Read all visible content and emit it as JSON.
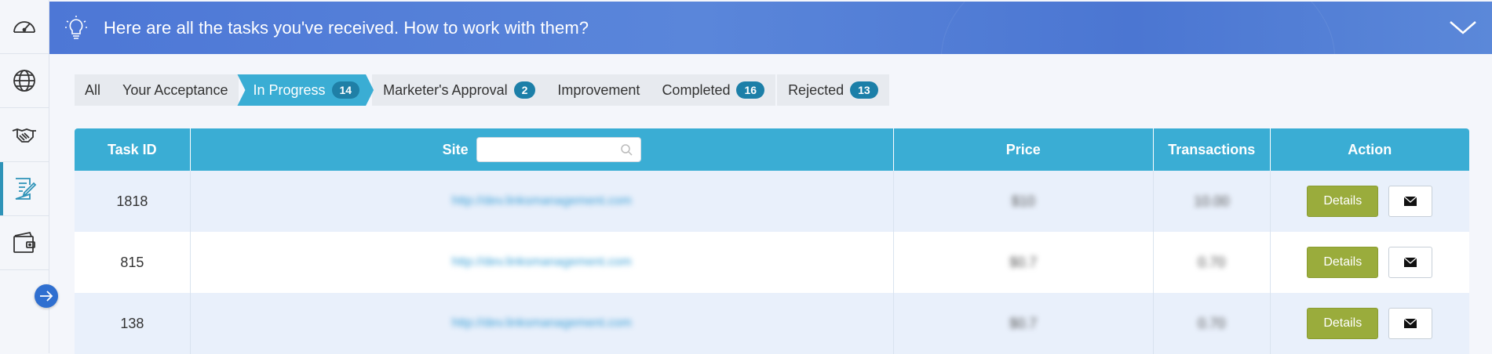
{
  "banner": {
    "title": "Here are all the tasks you've received. How to work with them?"
  },
  "sidebar": {
    "items": [
      {
        "icon": "speedometer-icon"
      },
      {
        "icon": "globe-icon"
      },
      {
        "icon": "handshake-icon"
      },
      {
        "icon": "edit-document-icon",
        "active": true
      },
      {
        "icon": "wallet-icon"
      }
    ]
  },
  "tabs": [
    {
      "label": "All"
    },
    {
      "label": "Your Acceptance"
    },
    {
      "label": "In Progress",
      "count": "14",
      "active": true
    },
    {
      "label": "Marketer's Approval",
      "count": "2"
    },
    {
      "label": "Improvement"
    },
    {
      "label": "Completed",
      "count": "16"
    },
    {
      "label": "Rejected",
      "count": "13"
    }
  ],
  "table": {
    "headers": {
      "task_id": "Task ID",
      "site": "Site",
      "price": "Price",
      "transactions": "Transactions",
      "action": "Action"
    },
    "search_placeholder": "",
    "rows": [
      {
        "task_id": "1818",
        "site": "http://dev.linksmanagement.com",
        "price": "$10",
        "transactions": "10.00"
      },
      {
        "task_id": "815",
        "site": "http://dev.linksmanagement.com",
        "price": "$0.7",
        "transactions": "0.70"
      },
      {
        "task_id": "138",
        "site": "http://dev.linksmanagement.com",
        "price": "$0.7",
        "transactions": "0.70"
      }
    ],
    "details_label": "Details"
  },
  "colors": {
    "accent": "#3aadd4",
    "banner": "#5582d8",
    "details": "#9aac3c",
    "badge": "#1c7fa8"
  }
}
